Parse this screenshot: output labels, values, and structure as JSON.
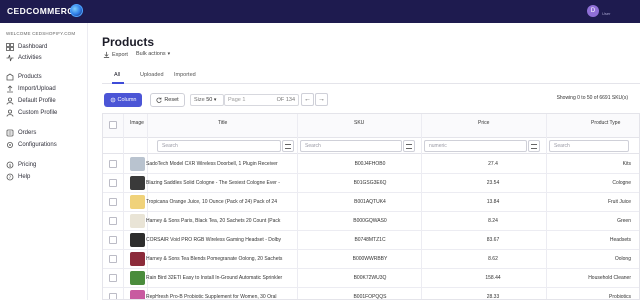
{
  "header": {
    "logo_text": "CEDCOMMERCE",
    "user_initial": "D",
    "user_name": "",
    "user_role": "User"
  },
  "sidebar": {
    "welcome": "WELCOME CEDSHOPIFY.COM",
    "items": [
      {
        "label": "Dashboard",
        "icon": "dashboard-icon"
      },
      {
        "label": "Activities",
        "icon": "activity-icon"
      },
      {
        "label": "Products",
        "icon": "products-icon"
      },
      {
        "label": "Import/Upload",
        "icon": "upload-icon"
      },
      {
        "label": "Default Profile",
        "icon": "profile-icon"
      },
      {
        "label": "Custom Profile",
        "icon": "custom-profile-icon"
      },
      {
        "label": "Orders",
        "icon": "orders-icon"
      },
      {
        "label": "Configurations",
        "icon": "gear-icon"
      },
      {
        "label": "Pricing",
        "icon": "pricing-icon"
      },
      {
        "label": "Help",
        "icon": "help-icon"
      }
    ]
  },
  "page": {
    "title": "Products",
    "export_label": "Export",
    "bulk_actions_label": "Bulk actions"
  },
  "tabs": [
    "All",
    "Uploaded",
    "Imported"
  ],
  "controls": {
    "column_label": "Column",
    "reset_label": "Reset",
    "size_label": "Size",
    "size_value": "50",
    "page_label": "Page 1",
    "page_of": "OF 134",
    "showing": "Showing 0 to 50 of 6691 SKU(s)"
  },
  "table": {
    "columns": [
      "Image",
      "Title",
      "SKU",
      "Price",
      "Product Type"
    ],
    "filters": {
      "title_placeholder": "Search",
      "sku_placeholder": "Search",
      "price_placeholder": "numeric",
      "type_placeholder": "Search"
    },
    "rows": [
      {
        "title": "SadoTech Model CXR Wireless Doorbell, 1 Plugin Receiver",
        "sku": "B00J4FHOB0",
        "price": "27.4",
        "type": "Kits",
        "thumb": "#b9c3cf"
      },
      {
        "title": "Blazing Saddles Solid Cologne - The Sexiest Cologne Ever -",
        "sku": "B01GSG3E6Q",
        "price": "23.54",
        "type": "Cologne",
        "thumb": "#3a3a3a"
      },
      {
        "title": "Tropicana Orange Juice, 10 Ounce (Pack of 24) Pack of 24",
        "sku": "B001AQTUK4",
        "price": "13.84",
        "type": "Fruit Juice",
        "thumb": "#f0d27a"
      },
      {
        "title": "Harney & Sons Paris, Black Tea, 20 Sachets 20 Count (Pack",
        "sku": "B000GQWAS0",
        "price": "8.24",
        "type": "Green",
        "thumb": "#e9e4d6"
      },
      {
        "title": "CORSAIR Void PRO RGB Wireless Gaming Headset - Dolby",
        "sku": "B0748MTZ1C",
        "price": "83.67",
        "type": "Headsets",
        "thumb": "#2c2c2c"
      },
      {
        "title": "Harney & Sons Tea Blends Pomegranate Oolong, 20 Sachets",
        "sku": "B000WWRBBY",
        "price": "8.62",
        "type": "Oolong",
        "thumb": "#8c2b3a"
      },
      {
        "title": "Rain Bird 32ETI Easy to Install In-Ground Automatic Sprinkler",
        "sku": "B00K72WU3Q",
        "price": "158.44",
        "type": "Household Cleaner",
        "thumb": "#4a8c3c"
      },
      {
        "title": "RepHresh Pro-B Probiotic Supplement for Women, 30 Oral",
        "sku": "B001FOPQQS",
        "price": "28.33",
        "type": "Probiotics",
        "thumb": "#c85aa0"
      }
    ]
  }
}
